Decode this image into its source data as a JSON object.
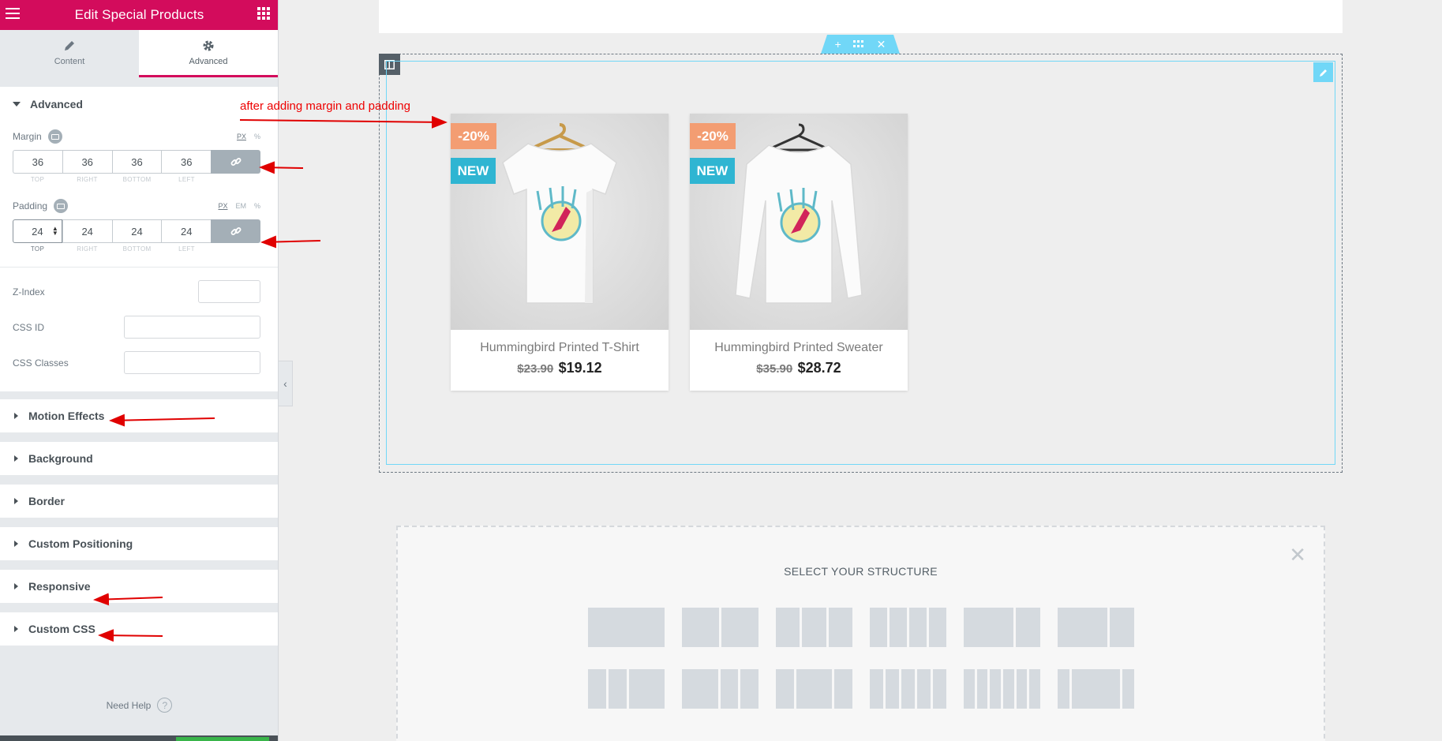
{
  "sidebar": {
    "title": "Edit Special Products",
    "tabs": [
      {
        "label": "Content",
        "icon": "pencil-icon"
      },
      {
        "label": "Advanced",
        "icon": "gear-icon"
      }
    ],
    "advanced_section": {
      "heading": "Advanced",
      "margin": {
        "label": "Margin",
        "units": [
          "PX",
          "%"
        ],
        "values": [
          "36",
          "36",
          "36",
          "36"
        ],
        "sides": [
          "TOP",
          "RIGHT",
          "BOTTOM",
          "LEFT"
        ]
      },
      "padding": {
        "label": "Padding",
        "units": [
          "PX",
          "EM",
          "%"
        ],
        "values": [
          "24",
          "24",
          "24",
          "24"
        ],
        "sides": [
          "TOP",
          "RIGHT",
          "BOTTOM",
          "LEFT"
        ]
      },
      "z_index_label": "Z-Index",
      "css_id_label": "CSS ID",
      "css_classes_label": "CSS Classes"
    },
    "collapsed_sections": [
      "Motion Effects",
      "Background",
      "Border",
      "Custom Positioning",
      "Responsive",
      "Custom CSS"
    ],
    "need_help": "Need Help"
  },
  "canvas": {
    "annotation": "after adding margin and padding",
    "products": [
      {
        "name": "Hummingbird Printed T-Shirt",
        "old_price": "$23.90",
        "price": "$19.12",
        "discount_badge": "-20%",
        "new_badge": "NEW"
      },
      {
        "name": "Hummingbird Printed Sweater",
        "old_price": "$35.90",
        "price": "$28.72",
        "discount_badge": "-20%",
        "new_badge": "NEW"
      }
    ],
    "structure_title": "SELECT YOUR STRUCTURE"
  },
  "colors": {
    "brand": "#d30c5c",
    "accent_blue": "#71d7f7",
    "badge_discount": "#f39d72",
    "badge_new": "#2fb5d2",
    "annotation_red": "#e00000"
  }
}
